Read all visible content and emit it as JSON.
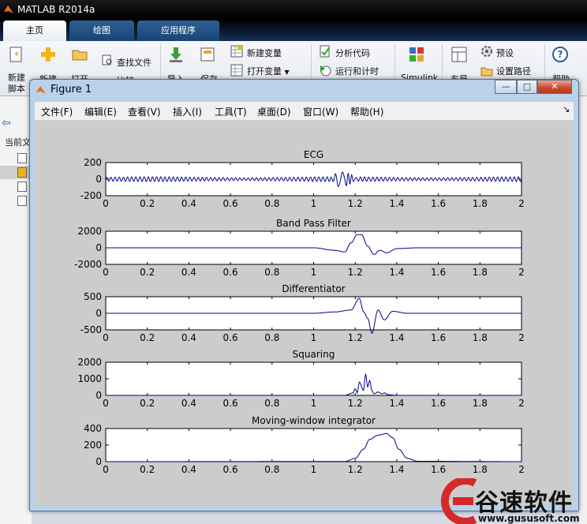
{
  "app": {
    "title": "MATLAB R2014a"
  },
  "tabs": [
    {
      "label": "主页"
    },
    {
      "label": "绘图"
    },
    {
      "label": "应用程序"
    }
  ],
  "ribbon": {
    "new_script": "新建\n脚本",
    "new": "新建",
    "open": "打开",
    "find_files": "查找文件",
    "compare": "比较",
    "import": "导入",
    "save": "保存",
    "new_variable": "新建变量",
    "open_variable": "打开变量",
    "analyze_code": "分析代码",
    "run_and_time": "运行和计时",
    "simulink": "Simulink",
    "layout": "布局",
    "preferences": "预设",
    "set_path": "设置路径",
    "help": "帮助"
  },
  "left_panel": {
    "current_folder": "当前文"
  },
  "figure": {
    "title": "Figure 1",
    "menus": [
      "文件(F)",
      "编辑(E)",
      "查看(V)",
      "插入(I)",
      "工具(T)",
      "桌面(D)",
      "窗口(W)",
      "帮助(H)"
    ],
    "buttons": {
      "minimize": "—",
      "maximize": "□",
      "close": "✕"
    }
  },
  "watermark": {
    "text": "谷速软件",
    "url": "www.gususoft.com"
  },
  "chart_data": [
    {
      "type": "line",
      "title": "ECG",
      "xlim": [
        0,
        2
      ],
      "ylim": [
        -200,
        200
      ],
      "yticks": [
        -200,
        0,
        200
      ],
      "xticks": [
        0,
        0.2,
        0.4,
        0.6,
        0.8,
        1,
        1.2,
        1.4,
        1.6,
        1.8,
        2
      ],
      "color": "#00008b",
      "signal": "dense oscillation, amplitude ~30, spike to ~110 / -110 near x=1.13"
    },
    {
      "type": "line",
      "title": "Band Pass Filter",
      "xlim": [
        0,
        2
      ],
      "ylim": [
        -2000,
        2000
      ],
      "yticks": [
        -2000,
        0,
        2000
      ],
      "xticks": [
        0,
        0.2,
        0.4,
        0.6,
        0.8,
        1,
        1.2,
        1.4,
        1.6,
        1.8,
        2
      ],
      "color": "#00008b",
      "x": [
        0,
        1.0,
        1.1,
        1.15,
        1.18,
        1.21,
        1.23,
        1.26,
        1.29,
        1.32,
        1.35,
        1.4,
        1.5,
        2.0
      ],
      "y": [
        0,
        0,
        -300,
        -500,
        600,
        1600,
        1600,
        200,
        -800,
        -300,
        -600,
        -100,
        0,
        0
      ]
    },
    {
      "type": "line",
      "title": "Differentiator",
      "xlim": [
        0,
        2
      ],
      "ylim": [
        -500,
        500
      ],
      "yticks": [
        -500,
        0,
        500
      ],
      "xticks": [
        0,
        0.2,
        0.4,
        0.6,
        0.8,
        1,
        1.2,
        1.4,
        1.6,
        1.8,
        2
      ],
      "color": "#00008b",
      "x": [
        0,
        1.0,
        1.1,
        1.18,
        1.22,
        1.24,
        1.26,
        1.28,
        1.31,
        1.34,
        1.38,
        1.45,
        2.0
      ],
      "y": [
        0,
        0,
        40,
        100,
        450,
        50,
        -150,
        -600,
        100,
        -200,
        60,
        0,
        0
      ]
    },
    {
      "type": "line",
      "title": "Squaring",
      "xlim": [
        0,
        2
      ],
      "ylim": [
        0,
        2000
      ],
      "yticks": [
        0,
        1000,
        2000
      ],
      "xticks": [
        0,
        0.2,
        0.4,
        0.6,
        0.8,
        1,
        1.2,
        1.4,
        1.6,
        1.8,
        2
      ],
      "color": "#00008b",
      "x": [
        0,
        1.15,
        1.19,
        1.2,
        1.21,
        1.22,
        1.24,
        1.25,
        1.26,
        1.27,
        1.28,
        1.29,
        1.31,
        1.33,
        1.34,
        1.36,
        1.4,
        2.0
      ],
      "y": [
        0,
        0,
        150,
        400,
        150,
        800,
        300,
        1300,
        500,
        900,
        300,
        100,
        200,
        100,
        150,
        40,
        0,
        0
      ]
    },
    {
      "type": "line",
      "title": "Moving-window integrator",
      "xlim": [
        0,
        2
      ],
      "ylim": [
        0,
        400
      ],
      "yticks": [
        0,
        200,
        400
      ],
      "xticks": [
        0,
        0.2,
        0.4,
        0.6,
        0.8,
        1,
        1.2,
        1.4,
        1.6,
        1.8,
        2
      ],
      "color": "#00008b",
      "x": [
        0,
        1.15,
        1.2,
        1.24,
        1.27,
        1.31,
        1.35,
        1.38,
        1.41,
        1.45,
        1.5,
        2.0
      ],
      "y": [
        0,
        2,
        40,
        150,
        270,
        320,
        340,
        290,
        150,
        40,
        5,
        0
      ]
    }
  ]
}
